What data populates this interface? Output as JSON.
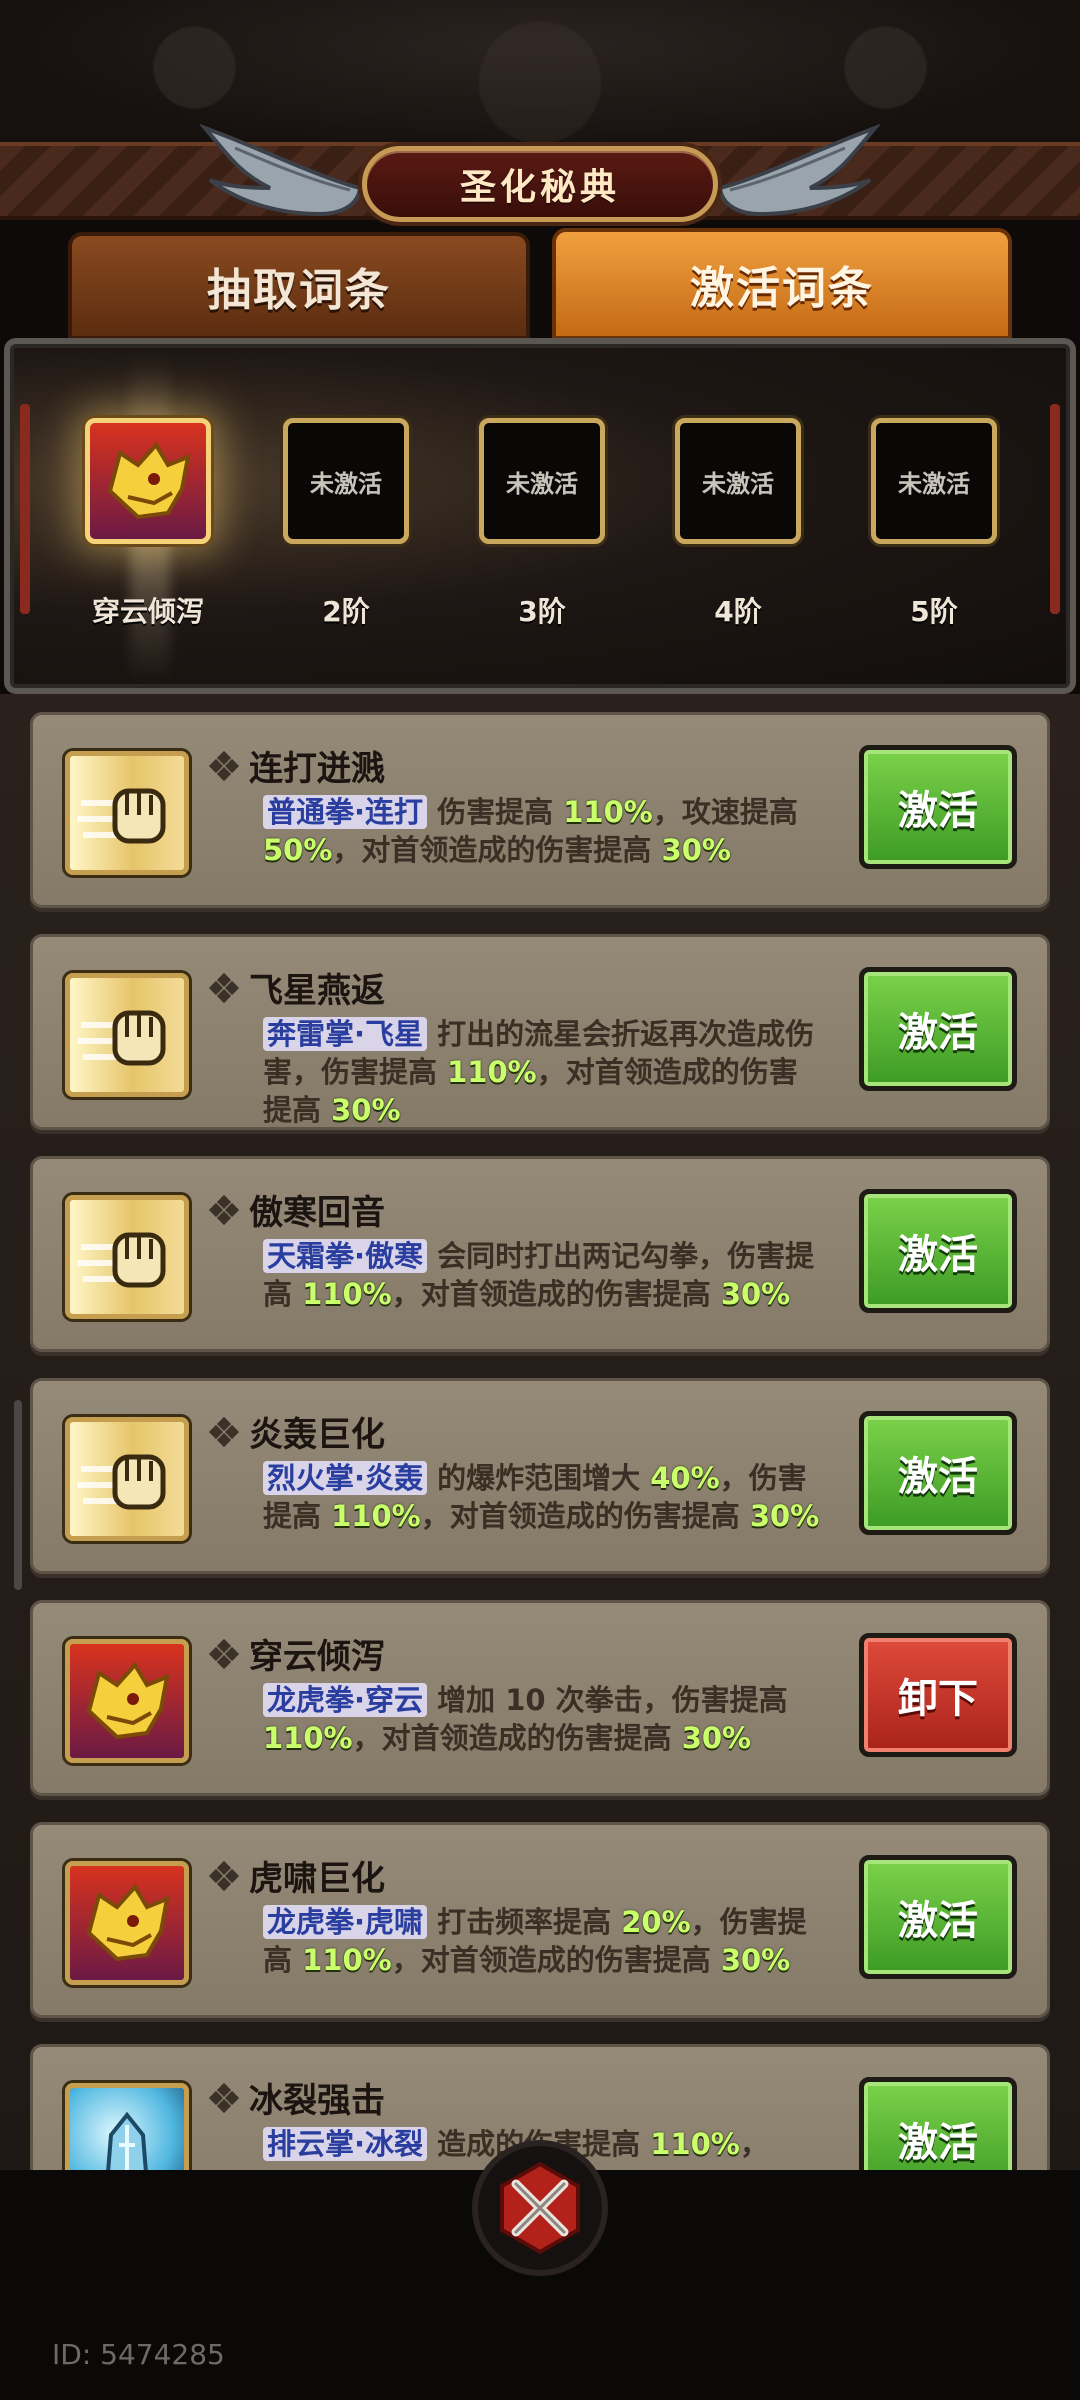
{
  "header": {
    "title": "圣化秘典"
  },
  "tabs": [
    {
      "label": "抽取词条",
      "active": false
    },
    {
      "label": "激活词条",
      "active": true
    }
  ],
  "stages": [
    {
      "label": "穿云倾泻",
      "slot_text": "",
      "active": true
    },
    {
      "label": "2阶",
      "slot_text": "未激活",
      "active": false
    },
    {
      "label": "3阶",
      "slot_text": "未激活",
      "active": false
    },
    {
      "label": "4阶",
      "slot_text": "未激活",
      "active": false
    },
    {
      "label": "5阶",
      "slot_text": "未激活",
      "active": false
    }
  ],
  "abilities": [
    {
      "name": "连打迸溅",
      "icon": "fist-icon",
      "desc": [
        {
          "t": "普通拳·连打",
          "k": "skill"
        },
        {
          "t": " 伤害提高 "
        },
        {
          "t": "110%",
          "k": "num"
        },
        {
          "t": "，攻速提高 "
        },
        {
          "t": "50%",
          "k": "num"
        },
        {
          "t": "，对首领造成的伤害提高 "
        },
        {
          "t": "30%",
          "k": "num"
        }
      ],
      "button": "激活",
      "button_type": "activate"
    },
    {
      "name": "飞星燕返",
      "icon": "fist-icon",
      "desc": [
        {
          "t": "奔雷掌·飞星",
          "k": "skill"
        },
        {
          "t": " 打出的流星会折返再次造成伤害，伤害提高 "
        },
        {
          "t": "110%",
          "k": "num"
        },
        {
          "t": "，对首领造成的伤害提高 "
        },
        {
          "t": "30%",
          "k": "num"
        }
      ],
      "button": "激活",
      "button_type": "activate"
    },
    {
      "name": "傲寒回音",
      "icon": "fist-icon",
      "desc": [
        {
          "t": "天霜拳·傲寒",
          "k": "skill"
        },
        {
          "t": " 会同时打出两记勾拳，伤害提高 "
        },
        {
          "t": "110%",
          "k": "num"
        },
        {
          "t": "，对首领造成的伤害提高 "
        },
        {
          "t": "30%",
          "k": "num"
        }
      ],
      "button": "激活",
      "button_type": "activate"
    },
    {
      "name": "炎轰巨化",
      "icon": "fist-icon",
      "desc": [
        {
          "t": "烈火掌·炎轰",
          "k": "skill"
        },
        {
          "t": " 的爆炸范围增大 "
        },
        {
          "t": "40%",
          "k": "num"
        },
        {
          "t": "，伤害提高 "
        },
        {
          "t": "110%",
          "k": "num"
        },
        {
          "t": "，对首领造成的伤害提高 "
        },
        {
          "t": "30%",
          "k": "num"
        }
      ],
      "button": "激活",
      "button_type": "activate"
    },
    {
      "name": "穿云倾泻",
      "icon": "tiger-icon",
      "desc": [
        {
          "t": "龙虎拳·穿云",
          "k": "skill"
        },
        {
          "t": " 增加 10 次拳击，伤害提高 "
        },
        {
          "t": "110%",
          "k": "num"
        },
        {
          "t": "，对首领造成的伤害提高 "
        },
        {
          "t": "30%",
          "k": "num"
        }
      ],
      "button": "卸下",
      "button_type": "unequip"
    },
    {
      "name": "虎啸巨化",
      "icon": "tiger-icon",
      "desc": [
        {
          "t": "龙虎拳·虎啸",
          "k": "skill"
        },
        {
          "t": " 打击频率提高 "
        },
        {
          "t": "20%",
          "k": "num"
        },
        {
          "t": "，伤害提高 "
        },
        {
          "t": "110%",
          "k": "num"
        },
        {
          "t": "，对首领造成的伤害提高 "
        },
        {
          "t": "30%",
          "k": "num"
        }
      ],
      "button": "激活",
      "button_type": "activate"
    },
    {
      "name": "冰裂强击",
      "icon": "ice-icon",
      "desc": [
        {
          "t": "排云掌·冰裂",
          "k": "skill"
        },
        {
          "t": " 造成的伤害提高 "
        },
        {
          "t": "110%",
          "k": "num"
        },
        {
          "t": "，"
        }
      ],
      "button": "激活",
      "button_type": "activate"
    }
  ],
  "footer": {
    "id_text": "ID: 5474285"
  }
}
